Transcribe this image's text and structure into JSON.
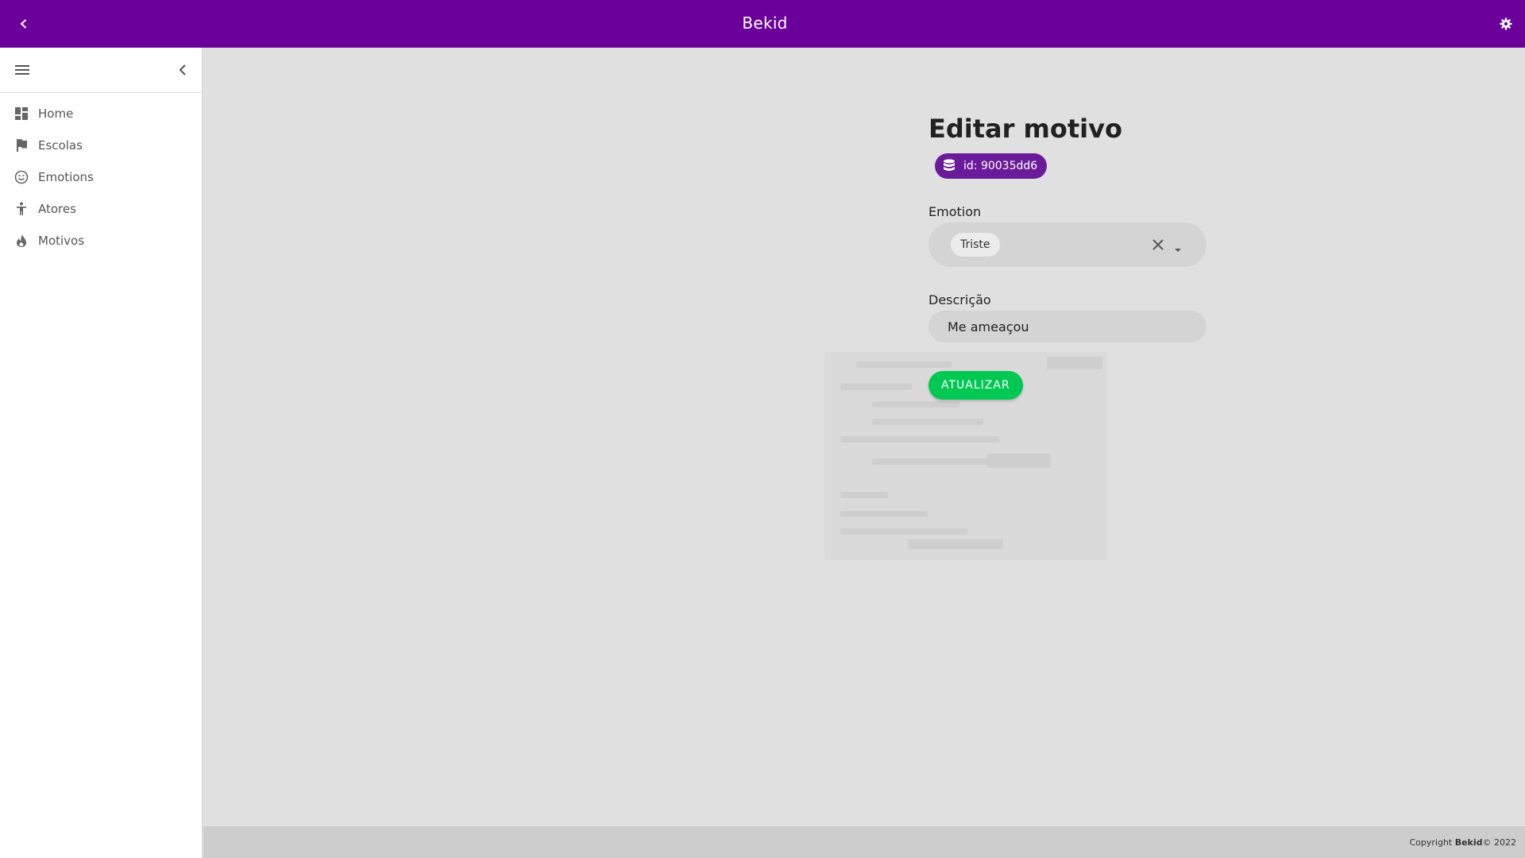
{
  "app": {
    "title": "Bekid"
  },
  "sidebar": {
    "items": [
      {
        "label": "Home",
        "icon": "dashboard-icon"
      },
      {
        "label": "Escolas",
        "icon": "flag-icon"
      },
      {
        "label": "Emotions",
        "icon": "smiley-icon"
      },
      {
        "label": "Atores",
        "icon": "person-icon"
      },
      {
        "label": "Motivos",
        "icon": "fire-icon"
      }
    ]
  },
  "form": {
    "title": "Editar motivo",
    "id_chip": "id: 90035dd6",
    "emotion_label": "Emotion",
    "emotion_selected": "Triste",
    "description_label": "Descrição",
    "description_value": "Me ameaçou",
    "submit_label": "ATUALIZAR"
  },
  "footer": {
    "prefix": "Copyright ",
    "brand": "Bekid",
    "suffix": " © 2022"
  },
  "colors": {
    "topbar": "#6a0099",
    "chip": "#6a1b9a",
    "submit": "#00c853"
  }
}
